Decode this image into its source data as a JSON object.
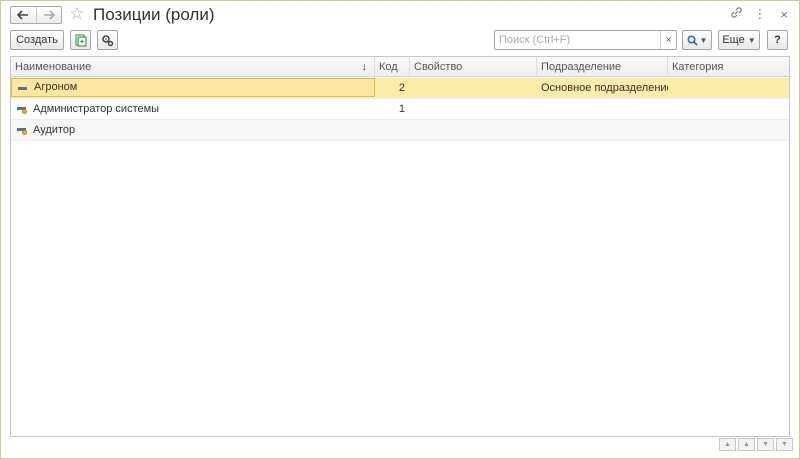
{
  "window": {
    "title": "Позиции (роли)"
  },
  "titlebar": {
    "back_icon": "arrow-left-icon",
    "forward_icon": "arrow-right-icon",
    "favorite_icon": "star-icon",
    "link_icon": "link-icon",
    "menu_icon": "more-vertical-icon",
    "close_icon": "close-icon"
  },
  "toolbar": {
    "create_label": "Создать",
    "search_placeholder": "Поиск (Ctrl+F)",
    "search_clear": "×",
    "more_label": "Еще",
    "help_label": "?"
  },
  "table": {
    "columns": [
      "Наименование",
      "Код",
      "Свойство",
      "Подразделение",
      "Категория"
    ],
    "sort_indicator": "↓",
    "rows": [
      {
        "name": "Агроном",
        "code": "2",
        "property": "",
        "department": "Основное подразделение",
        "category": "",
        "selected": true
      },
      {
        "name": "Администратор системы",
        "code": "1",
        "property": "",
        "department": "",
        "category": ""
      },
      {
        "name": "Аудитор",
        "code": "",
        "property": "",
        "department": "",
        "category": ""
      }
    ]
  },
  "colors": {
    "selected_row": "#fbeda8",
    "selected_border": "#e0b84a",
    "accent": "#2e6ab5"
  }
}
